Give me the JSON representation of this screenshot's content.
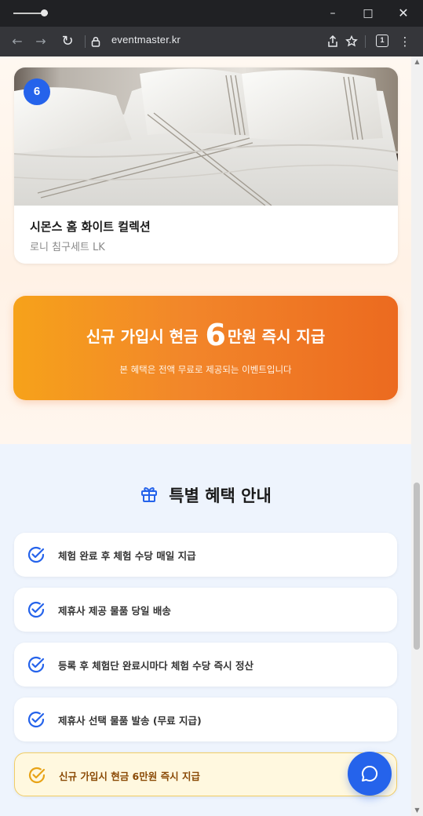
{
  "browser": {
    "url": "eventmaster.kr",
    "tab_count": "1",
    "icons": [
      "back-icon",
      "forward-icon",
      "reload-icon",
      "lock-icon",
      "share-icon",
      "bookmark-icon",
      "tabs-icon",
      "menu-icon"
    ]
  },
  "product": {
    "rank": "6",
    "title": "시몬스 홈 화이트 컬렉션",
    "subtitle": "로니 침구세트 LK"
  },
  "promo": {
    "title_before": "신규 가입시 현금",
    "title_big": "6",
    "title_after": "만원 즉시 지급",
    "subtitle": "본 혜택은 전액 무료로 제공되는 이벤트입니다"
  },
  "benefits": {
    "title": "특별 혜택 안내",
    "items": [
      {
        "label": "체험 완료 후 체험 수당 매일 지급"
      },
      {
        "label": "제휴사 제공 물품 당일 배송"
      },
      {
        "label": "등록 후 체험단 완료시마다 체험 수당 즉시 정산"
      },
      {
        "label": "제휴사 선택 물품 발송 (무료 지급)"
      },
      {
        "label": "신규 가입시 현금 6만원 즉시 지급",
        "highlight": true
      }
    ]
  },
  "colors": {
    "accent": "#2563eb",
    "promo_start": "#f6a21a",
    "promo_end": "#ec6a1f",
    "highlight_bg": "#fff8df"
  }
}
